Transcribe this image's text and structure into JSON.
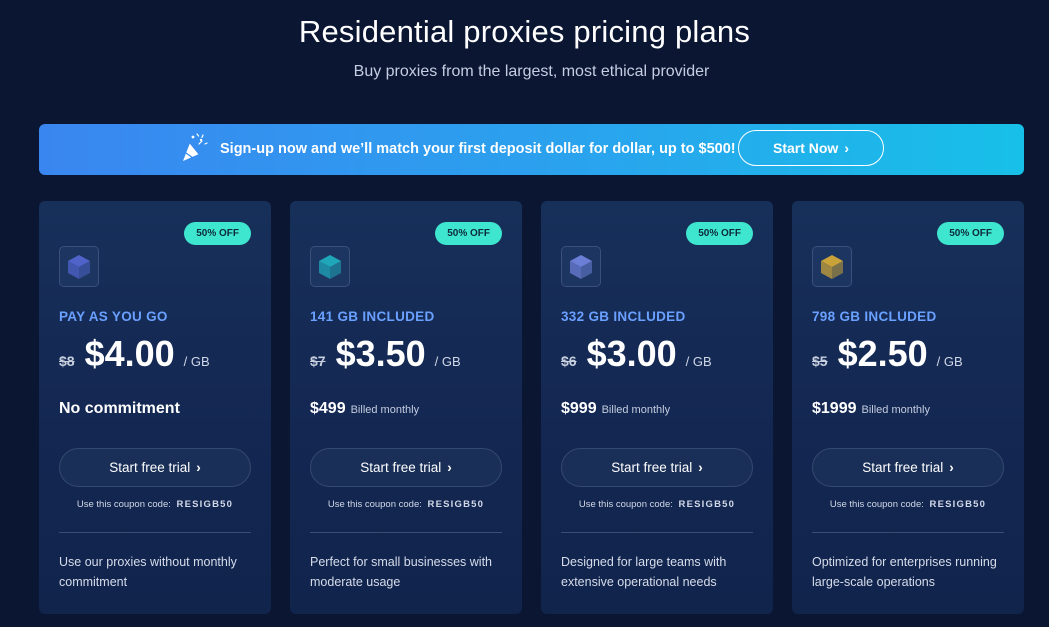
{
  "header": {
    "title": "Residential proxies pricing plans",
    "subtitle": "Buy proxies from the largest, most ethical provider"
  },
  "banner": {
    "icon": "party-popper-icon",
    "text": "Sign-up now and we’ll match your first deposit dollar for dollar, up to $500!",
    "cta_label": "Start Now",
    "gradient_start": "#3a86f0",
    "gradient_end": "#17c0e8"
  },
  "plans": [
    {
      "badge": "50% OFF",
      "icon": "cube-icon",
      "icon_color": "#4f63c9",
      "name": "PAY AS YOU GO",
      "old_price": "$8",
      "price": "$4.00",
      "unit": "/ GB",
      "billing_amount": "No commitment",
      "billing_label": "",
      "button_label": "Start free trial",
      "coupon_label": "Use this coupon code:",
      "coupon_code": "RESIGB50",
      "description": "Use our proxies without monthly commitment"
    },
    {
      "badge": "50% OFF",
      "icon": "cube-icon",
      "icon_color": "#1fa6b8",
      "name": "141 GB INCLUDED",
      "old_price": "$7",
      "price": "$3.50",
      "unit": "/ GB",
      "billing_amount": "$499",
      "billing_label": "Billed monthly",
      "button_label": "Start free trial",
      "coupon_label": "Use this coupon code:",
      "coupon_code": "RESIGB50",
      "description": "Perfect for small businesses with moderate usage"
    },
    {
      "badge": "50% OFF",
      "icon": "cube-icon",
      "icon_color": "#6b7fd6",
      "name": "332 GB INCLUDED",
      "old_price": "$6",
      "price": "$3.00",
      "unit": "/ GB",
      "billing_amount": "$999",
      "billing_label": "Billed monthly",
      "button_label": "Start free trial",
      "coupon_label": "Use this coupon code:",
      "coupon_code": "RESIGB50",
      "description": "Designed for large teams with extensive operational needs"
    },
    {
      "badge": "50% OFF",
      "icon": "cube-icon",
      "icon_color": "#c9a23a",
      "name": "798 GB INCLUDED",
      "old_price": "$5",
      "price": "$2.50",
      "unit": "/ GB",
      "billing_amount": "$1999",
      "billing_label": "Billed monthly",
      "button_label": "Start free trial",
      "coupon_label": "Use this coupon code:",
      "coupon_code": "RESIGB50",
      "description": "Optimized for enterprises running large-scale operations"
    }
  ],
  "colors": {
    "background": "#0b1633",
    "accent_blue": "#6aa0ff",
    "badge": "#3fe6cf"
  }
}
